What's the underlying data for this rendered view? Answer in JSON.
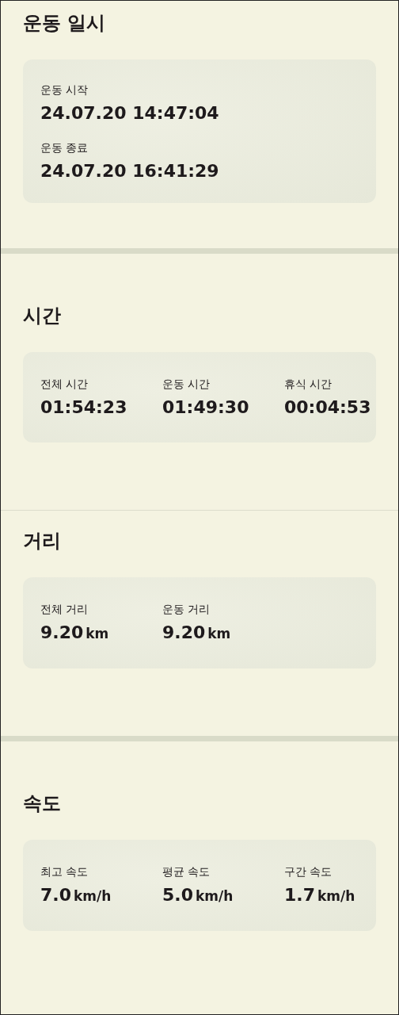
{
  "sections": [
    {
      "title": "운동 일시",
      "kind": "stack",
      "divider": {
        "kind": "thick"
      },
      "items": [
        {
          "label": "운동 시작",
          "value": "24.07.20 14:47:04"
        },
        {
          "label": "운동 종료",
          "value": "24.07.20 16:41:29"
        }
      ]
    },
    {
      "title": "시간",
      "kind": "row",
      "divider": {
        "kind": "thin"
      },
      "items": [
        {
          "label": "전체 시간",
          "value": "01:54:23"
        },
        {
          "label": "운동 시간",
          "value": "01:49:30"
        },
        {
          "label": "휴식 시간",
          "value": "00:04:53"
        }
      ]
    },
    {
      "title": "거리",
      "kind": "row",
      "divider": {
        "kind": "thick"
      },
      "items": [
        {
          "label": "전체 거리",
          "value": "9.20",
          "unit": "km"
        },
        {
          "label": "운동 거리",
          "value": "9.20",
          "unit": "km"
        }
      ]
    },
    {
      "title": "속도",
      "kind": "row",
      "items": [
        {
          "label": "최고 속도",
          "value": "7.0",
          "unit": "km/h"
        },
        {
          "label": "평균 속도",
          "value": "5.0",
          "unit": "km/h"
        },
        {
          "label": "구간 속도",
          "value": "1.7",
          "unit": "km/h"
        }
      ]
    }
  ]
}
